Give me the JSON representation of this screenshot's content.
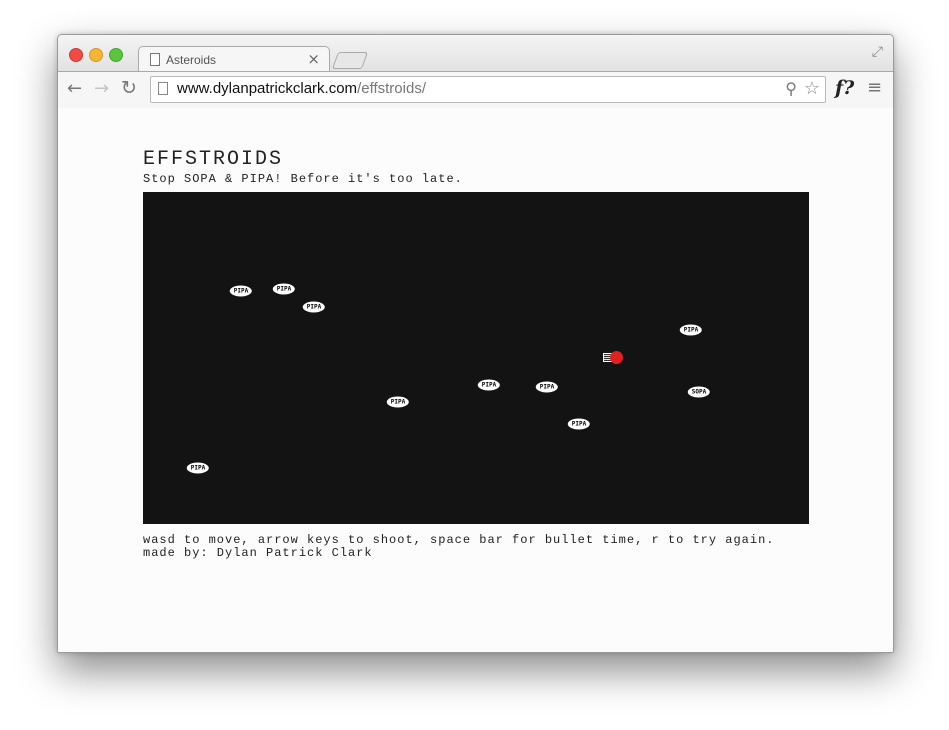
{
  "browser": {
    "tab": {
      "title": "Asteroids",
      "close": "×"
    },
    "url": {
      "host": "www.dylanpatrickclark.com",
      "path": "/effstroids/"
    },
    "icons": {
      "back": "back-arrow-icon",
      "forward": "forward-arrow-icon",
      "reload": "reload-icon",
      "zoom": "zoom-icon",
      "bookmark": "star-icon",
      "extension": "f?",
      "menu": "menu-icon",
      "fullscreen": "fullscreen-icon"
    }
  },
  "page": {
    "title": "EFFSTROIDS",
    "tagline": "Stop SOPA & PIPA! Before it's too late.",
    "instructions": "wasd to move, arrow keys to shoot, space bar for bullet time, r to try again.",
    "credit": "made by: Dylan Patrick Clark"
  },
  "game": {
    "background": "#131313",
    "asteroids": [
      {
        "label": "PIPA"
      },
      {
        "label": "PIPA"
      },
      {
        "label": "PIPA"
      },
      {
        "label": "PIPA"
      },
      {
        "label": "PIPA"
      },
      {
        "label": "PIPA"
      },
      {
        "label": "PIPA"
      },
      {
        "label": "SOPA"
      },
      {
        "label": "PIPA"
      },
      {
        "label": "PIPA"
      }
    ]
  }
}
